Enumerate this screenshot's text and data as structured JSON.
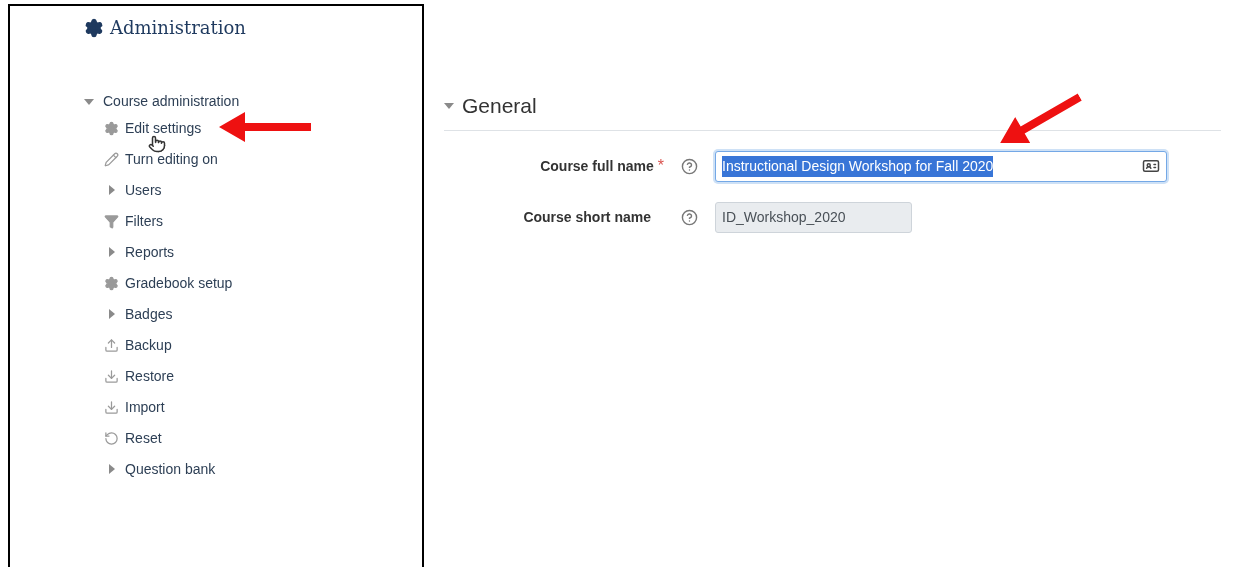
{
  "sidebar": {
    "title": "Administration",
    "section": {
      "label": "Course administration",
      "expanded": true,
      "items": [
        {
          "kind": "gear",
          "label": "Edit settings"
        },
        {
          "kind": "pencil",
          "label": "Turn editing on"
        },
        {
          "kind": "expander",
          "label": "Users",
          "expanded": false
        },
        {
          "kind": "filter",
          "label": "Filters"
        },
        {
          "kind": "expander",
          "label": "Reports",
          "expanded": false
        },
        {
          "kind": "gear",
          "label": "Gradebook setup"
        },
        {
          "kind": "expander",
          "label": "Badges",
          "expanded": false
        },
        {
          "kind": "upload",
          "label": "Backup"
        },
        {
          "kind": "download",
          "label": "Restore"
        },
        {
          "kind": "download",
          "label": "Import"
        },
        {
          "kind": "reset",
          "label": "Reset"
        },
        {
          "kind": "expander",
          "label": "Question bank",
          "expanded": false
        }
      ]
    }
  },
  "form": {
    "section": {
      "label": "General",
      "expanded": true
    },
    "fields": [
      {
        "label": "Course full name",
        "required_mark": "*",
        "value": "Instructional Design Workshop for Fall 2020",
        "focused": true,
        "text_selected": true,
        "disabled": false
      },
      {
        "label": "Course short name",
        "value": "ID_Workshop_2020",
        "focused": false,
        "text_selected": false,
        "disabled": true
      }
    ]
  }
}
